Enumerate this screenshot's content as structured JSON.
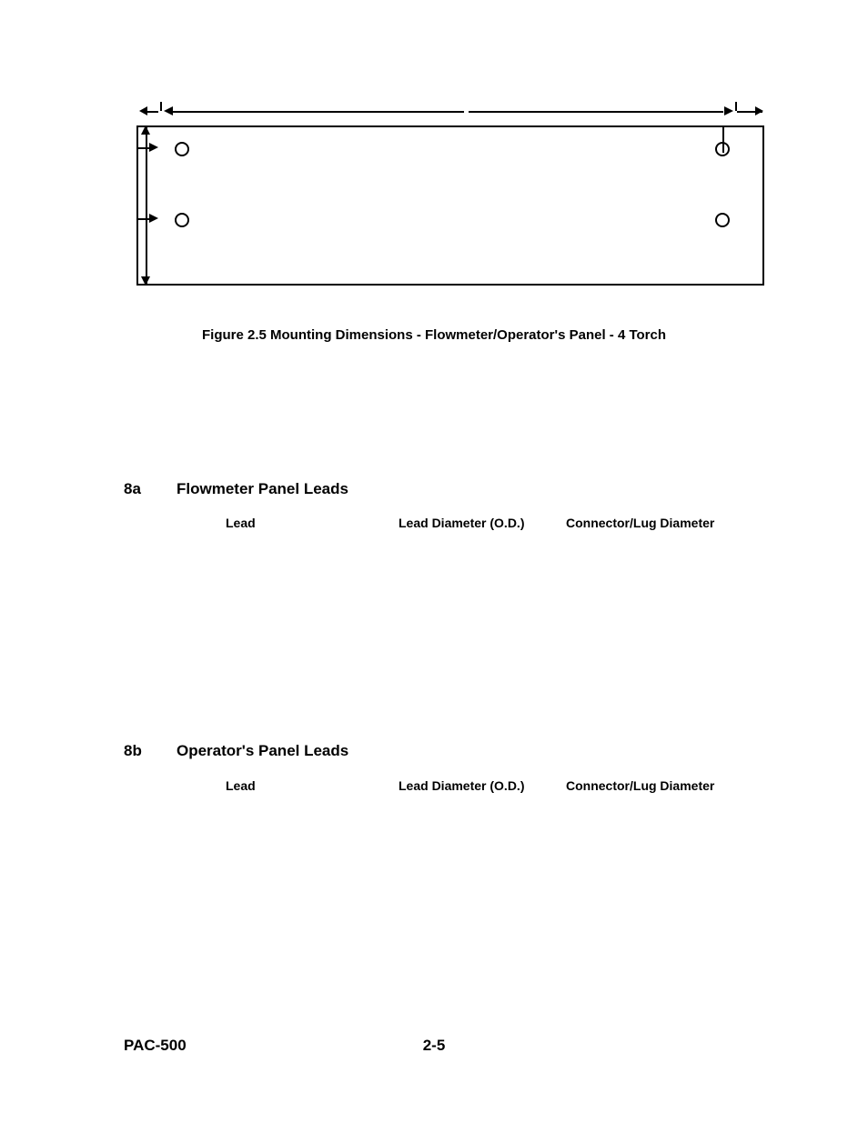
{
  "figure": {
    "caption": "Figure 2.5  Mounting Dimensions - Flowmeter/Operator's Panel - 4 Torch"
  },
  "sections": {
    "a": {
      "num": "8a",
      "title": "Flowmeter Panel Leads",
      "headers": {
        "lead": "Lead",
        "diameter": "Lead Diameter (O.D.)",
        "connector": "Connector/Lug Diameter"
      }
    },
    "b": {
      "num": "8b",
      "title": "Operator's Panel Leads",
      "headers": {
        "lead": "Lead",
        "diameter": "Lead Diameter (O.D.)",
        "connector": "Connector/Lug Diameter"
      }
    }
  },
  "footer": {
    "doc": "PAC-500",
    "page": "2-5"
  }
}
